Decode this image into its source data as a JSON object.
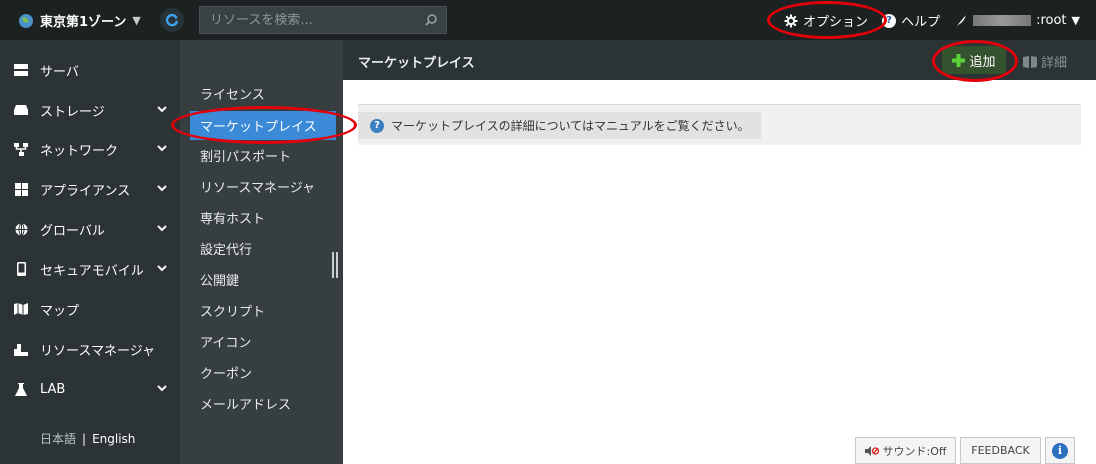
{
  "topbar": {
    "zone": "東京第1ゾーン",
    "search_placeholder": "リソースを検索...",
    "options": "オプション",
    "help": "ヘルプ",
    "user_suffix": ":root"
  },
  "leftnav": {
    "items": [
      {
        "label": "サーバ",
        "icon": "server-icon",
        "chevron": false
      },
      {
        "label": "ストレージ",
        "icon": "storage-icon",
        "chevron": true
      },
      {
        "label": "ネットワーク",
        "icon": "network-icon",
        "chevron": true
      },
      {
        "label": "アプライアンス",
        "icon": "appliance-icon",
        "chevron": true
      },
      {
        "label": "グローバル",
        "icon": "globe-icon",
        "chevron": true
      },
      {
        "label": "セキュアモバイル",
        "icon": "mobile-icon",
        "chevron": true
      },
      {
        "label": "マップ",
        "icon": "map-icon",
        "chevron": false
      },
      {
        "label": "リソースマネージャ",
        "icon": "resource-manager-icon",
        "chevron": false
      },
      {
        "label": "LAB",
        "icon": "flask-icon",
        "chevron": true
      }
    ],
    "lang_ja": "日本語",
    "lang_sep": "|",
    "lang_en": "English"
  },
  "submenu": {
    "items": [
      "ライセンス",
      "マーケットプレイス",
      "割引パスポート",
      "リソースマネージャ",
      "専有ホスト",
      "設定代行",
      "公開鍵",
      "スクリプト",
      "アイコン",
      "クーポン",
      "メールアドレス"
    ],
    "active_index": 1
  },
  "content": {
    "title": "マーケットプレイス",
    "add": "追加",
    "detail": "詳細",
    "info": "マーケットプレイスの詳細についてはマニュアルをご覧ください。"
  },
  "footer": {
    "sound": "サウンド:Off",
    "feedback": "FEEDBACK"
  },
  "colors": {
    "annotation": "#e3000b",
    "active": "#3a8ad8"
  }
}
